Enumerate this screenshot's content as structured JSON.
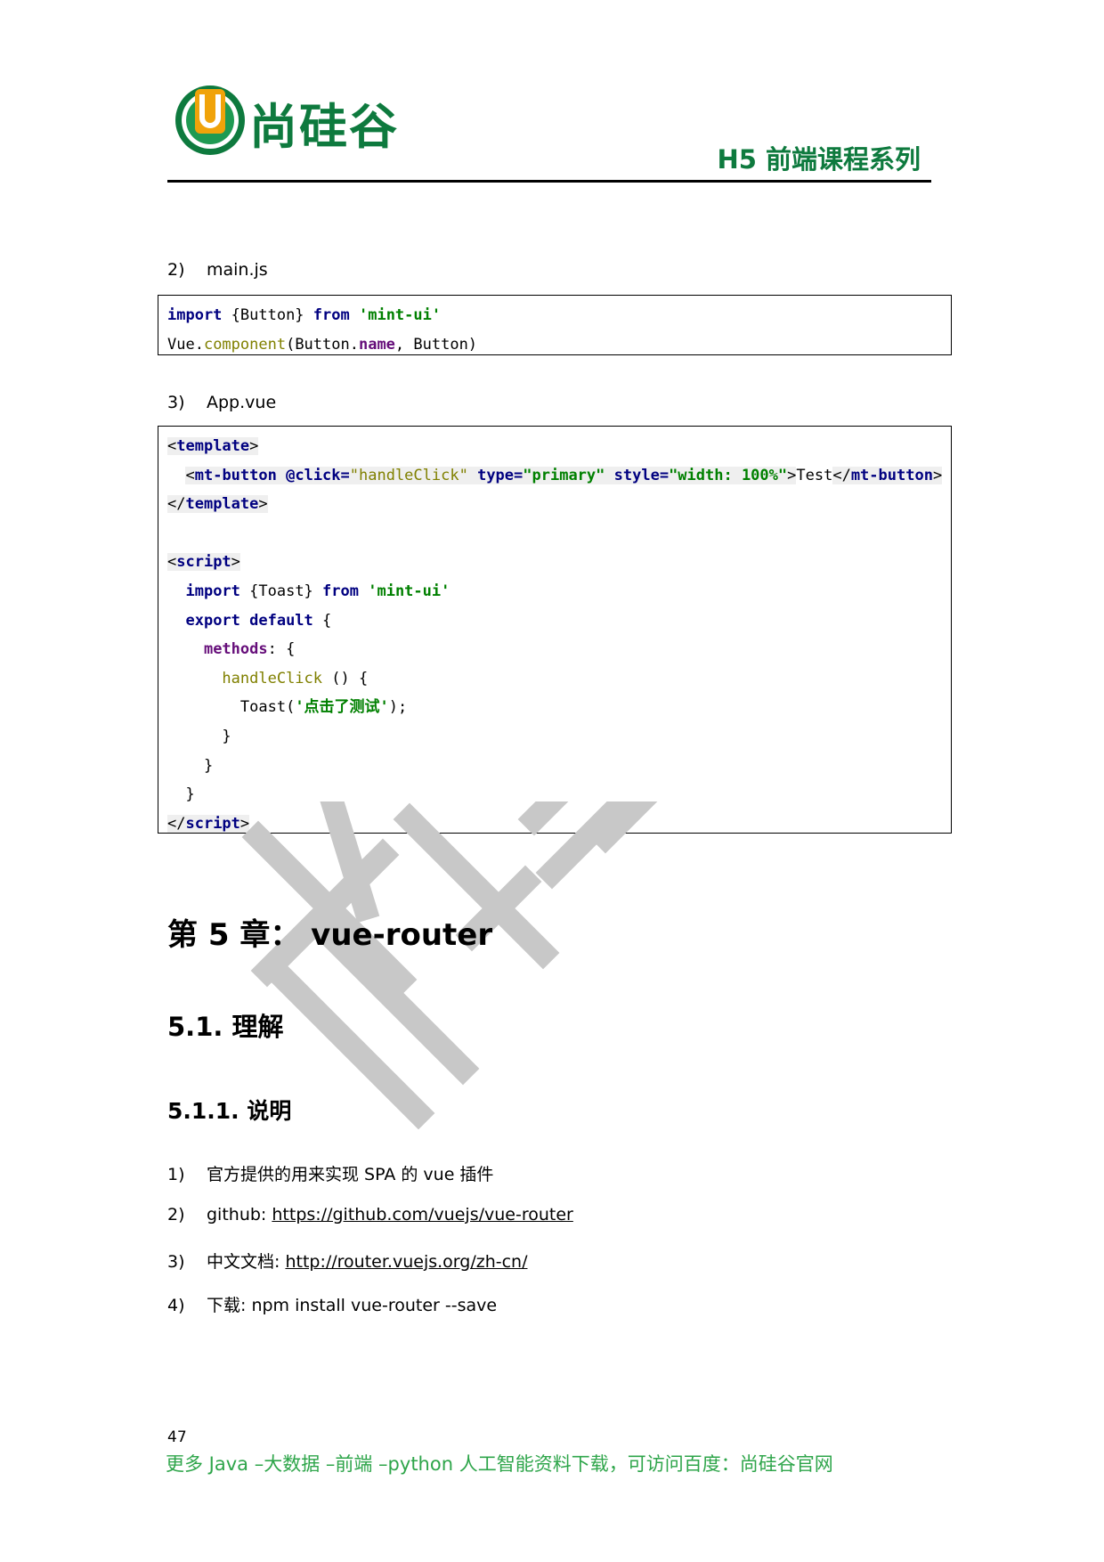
{
  "header": {
    "logo_text": "尚硅谷",
    "logo_letter": "U",
    "series_title": "H5 前端课程系列"
  },
  "sections": {
    "main_js": {
      "num": "2)",
      "label": "main.js"
    },
    "app_vue": {
      "num": "3)",
      "label": "App.vue"
    }
  },
  "code_main": {
    "l1": {
      "kw1": "import",
      "mid": " {Button} ",
      "kw2": "from",
      "sp": " ",
      "str": "'mint-ui'"
    },
    "l2": {
      "a": "Vue.",
      "fn": "component",
      "b": "(Button.",
      "prop": "name",
      "c": ", Button)"
    }
  },
  "code_app": {
    "template_tag": "template",
    "button_tag": "mt-button",
    "click_attr": "@click=",
    "click_val": "\"handleClick\"",
    "type_attr": "type=",
    "type_val": "\"primary\"",
    "style_attr": "style=",
    "style_val": "\"width: 100%\"",
    "button_text": "Test",
    "script_tag": "script",
    "import_kw": "import",
    "import_mid": " {Toast} ",
    "from_kw": "from",
    "import_str": "'mint-ui'",
    "export_kw": "export default",
    "export_rest": " {",
    "methods": "methods",
    "methods_rest": ": {",
    "handler": "handleClick",
    "handler_rest": " () {",
    "toast_call": "Toast(",
    "toast_str": "'点击了测试'",
    "toast_end": ");",
    "brace": "}"
  },
  "headings": {
    "chapter": "第 5 章：  vue-router",
    "section": "5.1.  理解",
    "subsection": "5.1.1.  说明"
  },
  "list": [
    {
      "num": "1)",
      "text": "官方提供的用来实现 SPA 的 vue 插件"
    },
    {
      "num": "2)",
      "prefix": "github: ",
      "link": "https://github.com/vuejs/vue-router"
    },
    {
      "num": "3)",
      "prefix": "中文文档: ",
      "link": "http://router.vuejs.org/zh-cn/"
    },
    {
      "num": "4)",
      "text": "下载: npm install vue-router --save"
    }
  ],
  "watermark_text": "尚硅谷",
  "footer": {
    "page_number": "47",
    "line": "更多 Java –大数据 –前端 –python 人工智能资料下载，可访问百度：尚硅谷官网"
  },
  "colors": {
    "brand_green": "#0e7a3e",
    "footer_green": "#2ea54a",
    "logo_orange": "#f0a30a"
  }
}
